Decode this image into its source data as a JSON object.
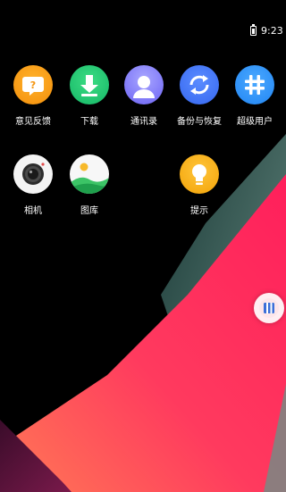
{
  "status_bar": {
    "time": "9:23",
    "battery_icon": "battery-icon"
  },
  "apps": [
    {
      "label": "意见反馈",
      "icon": "feedback-icon",
      "color": "#f7a21b"
    },
    {
      "label": "下载",
      "icon": "download-icon",
      "color": "#22c974"
    },
    {
      "label": "通讯录",
      "icon": "contacts-icon",
      "color": "#7d77f7"
    },
    {
      "label": "备份与恢复",
      "icon": "backup-restore-icon",
      "color": "#4679f5"
    },
    {
      "label": "超级用户",
      "icon": "superuser-icon",
      "color": "#2f95f6"
    },
    {
      "label": "相机",
      "icon": "camera-icon",
      "color": "#f4f4f4"
    },
    {
      "label": "图库",
      "icon": "gallery-icon",
      "color": "#2dbd5a"
    },
    {
      "label": "提示",
      "icon": "tips-icon",
      "color": "#f8b523"
    }
  ],
  "floating_ball": {
    "icon": "assistive-ball-icon"
  },
  "wallpaper": {
    "colors": [
      "#000000",
      "#ff2a5a",
      "#ff6a55",
      "#4a6a62"
    ]
  }
}
